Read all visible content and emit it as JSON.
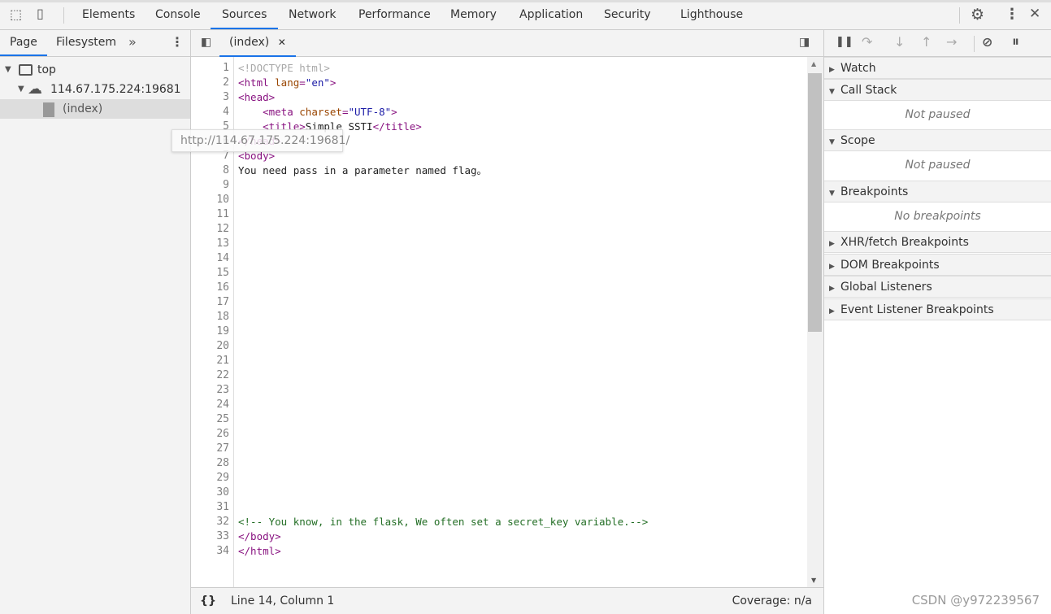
{
  "toolbar": {
    "tabs": [
      "Elements",
      "Console",
      "Sources",
      "Network",
      "Performance",
      "Memory",
      "Application",
      "Security",
      "Lighthouse"
    ],
    "active": "Sources",
    "accent": "#1a73e8"
  },
  "navigator": {
    "tabs": [
      "Page",
      "Filesystem"
    ],
    "tree": {
      "top": "top",
      "host": "114.67.175.224:19681",
      "file": "(index)"
    },
    "tooltip": "http://114.67.175.224:19681/"
  },
  "editor": {
    "tab": "(index)",
    "lines": [
      [
        [
          "doc",
          "<!DOCTYPE html>"
        ]
      ],
      [
        [
          "tag",
          "<html "
        ],
        [
          "attr",
          "lang"
        ],
        [
          "tag",
          "="
        ],
        [
          "val",
          "\"en\""
        ],
        [
          "tag",
          ">"
        ]
      ],
      [
        [
          "tag",
          "<head>"
        ]
      ],
      [
        [
          "txt",
          "    "
        ],
        [
          "tag",
          "<meta "
        ],
        [
          "attr",
          "charset"
        ],
        [
          "tag",
          "="
        ],
        [
          "val",
          "\"UTF-8\""
        ],
        [
          "tag",
          ">"
        ]
      ],
      [
        [
          "txt",
          "    "
        ],
        [
          "tag",
          "<title>"
        ],
        [
          "txt",
          "Simple SSTI"
        ],
        [
          "tag",
          "</title>"
        ]
      ],
      [
        [
          "tag",
          "</head>"
        ]
      ],
      [
        [
          "tag",
          "<body>"
        ]
      ],
      [
        [
          "txt",
          "You need pass in a parameter named flag。"
        ]
      ],
      [],
      [],
      [],
      [],
      [],
      [],
      [],
      [],
      [],
      [],
      [],
      [],
      [],
      [],
      [],
      [],
      [],
      [],
      [],
      [],
      [],
      [],
      [],
      [
        [
          "com",
          "<!-- You know, in the flask, We often set a secret_key variable.-->"
        ]
      ],
      [
        [
          "tag",
          "</body>"
        ]
      ],
      [
        [
          "tag",
          "</html>"
        ]
      ]
    ]
  },
  "status": {
    "position": "Line 14, Column 1",
    "coverage": "Coverage: n/a"
  },
  "debugger": {
    "sections": {
      "watch": "Watch",
      "call_stack": "Call Stack",
      "call_stack_empty": "Not paused",
      "scope": "Scope",
      "scope_empty": "Not paused",
      "breakpoints": "Breakpoints",
      "breakpoints_empty": "No breakpoints",
      "xhr": "XHR/fetch Breakpoints",
      "dom": "DOM Breakpoints",
      "global": "Global Listeners",
      "event": "Event Listener Breakpoints"
    }
  },
  "watermark": "CSDN @y972239567"
}
